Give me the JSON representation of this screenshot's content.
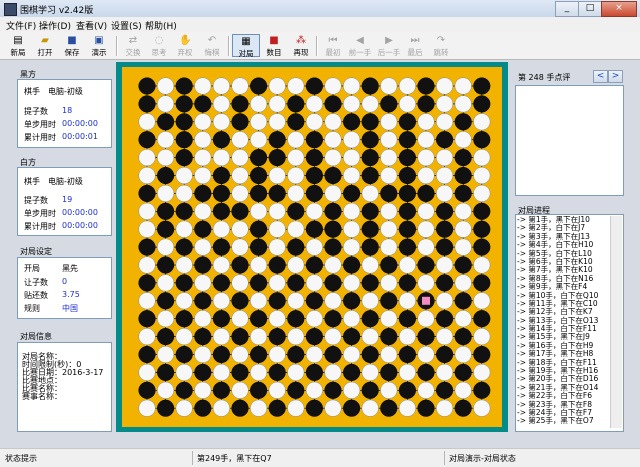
{
  "window": {
    "title": "围棋学习 v2.42版",
    "minimize": "_",
    "maximize": "□",
    "close": "×"
  },
  "menu": [
    "文件(F)",
    "操作(D)",
    "查看(V)",
    "设置(S)",
    "帮助(H)"
  ],
  "toolbar": {
    "new": "新局",
    "open": "打开",
    "save": "保存",
    "demo": "演示",
    "swap": "交换",
    "think": "思考",
    "pass": "弃权",
    "regret": "悔棋",
    "match": "对局",
    "count": "数目",
    "replay": "再现",
    "first": "最初",
    "prev": "前一手",
    "next": "后一手",
    "last": "最后",
    "jump": "跳转"
  },
  "black": {
    "header": "黑方",
    "player_label": "棋手",
    "player": "电脑-初级",
    "captured_label": "提子数",
    "captured": "18",
    "step_time_label": "单步用时",
    "step_time": "00:00:00",
    "total_time_label": "累计用时",
    "total_time": "00:00:01"
  },
  "white": {
    "header": "白方",
    "player_label": "棋手",
    "player": "电脑-初级",
    "captured_label": "提子数",
    "captured": "19",
    "step_time_label": "单步用时",
    "step_time": "00:00:00",
    "total_time_label": "累计用时",
    "total_time": "00:00:00"
  },
  "settings": {
    "header": "对局设定",
    "opening_label": "开局",
    "opening": "黑先",
    "handicap_label": "让子数",
    "handicap": "0",
    "komi_label": "贴还数",
    "komi": "3.75",
    "rules_label": "规则",
    "rules": "中国"
  },
  "info": {
    "header": "对局信息",
    "lines": [
      "对局名称：",
      "时间限制(秒)：0",
      "比赛日期：2016-3-17",
      "比赛地点：",
      "比赛名称：",
      "赛事名称："
    ]
  },
  "comment": {
    "header": "第 248 手点评",
    "prev_btn": "<",
    "next_btn": ">"
  },
  "history": {
    "header": "对局进程",
    "items": [
      "-> 第1手，黑下在J10",
      "-> 第2手，白下在J7",
      "-> 第3手，黑下在J13",
      "-> 第4手，白下在H10",
      "-> 第5手，白下在L10",
      "-> 第6手，白下在K10",
      "-> 第7手，黑下在K10",
      "-> 第8手，白下在N16",
      "-> 第9手，黑下在F4",
      "-> 第10手，白下在Q10",
      "-> 第11手，黑下在C10",
      "-> 第12手，白下在K7",
      "-> 第13手，白下在O13",
      "-> 第14手，白下在F11",
      "-> 第15手，黑下在J9",
      "-> 第16手，白下在H9",
      "-> 第17手，黑下在H8",
      "-> 第18手，白下在F11",
      "-> 第19手，黑下在H16",
      "-> 第20手，白下在D16",
      "-> 第21手，黑下在O14",
      "-> 第22手，白下在F6",
      "-> 第23手，黑下在F8",
      "-> 第24手，白下在F7",
      "-> 第25手，黑下在O7"
    ]
  },
  "status": {
    "left": "状态提示",
    "middle": "第249手，黑下在Q7",
    "right": "对局演示-对局状态"
  },
  "board": {
    "size": 19,
    "last_move": "Q7",
    "rows": [
      "BWBWWWBWWBWWBWWBWWB",
      "BWBBWBWWBWBWWBWBWWB",
      "WBBWWBWWBWWBBWBWWBW",
      "BWBWBWWBWBWWBWBWBWB",
      "WWBWWWBBWBWWBWBWWBW",
      "WBWWBWBWWBBWBWBWWBW",
      "BWWBBWBBWBWBWBBBWBW",
      "WBBWBBWWBWBWBWBWBWB",
      "WBWBWWBWWBBWBWBWBWB",
      "BWBWBWBWBWBWBWBWBWB",
      "WBWBWBWBWBWBWBWBWBW",
      "BWBWBWBWBWBWBWBWBWB",
      "WBWBWBWBWBWBWBWBWBW",
      "BWBWBWBWBWBWBWBWBWB",
      "WBWBWBWBWBWBWBWBWBW",
      "BWBWBWBWBWBWBWBWBWB",
      "WBWBWBWBWBWBWBWBWBW",
      "BWBWBWBWBWBWBWBWBWB",
      "WBWBWBWBWBWBWBWBWBW"
    ]
  }
}
